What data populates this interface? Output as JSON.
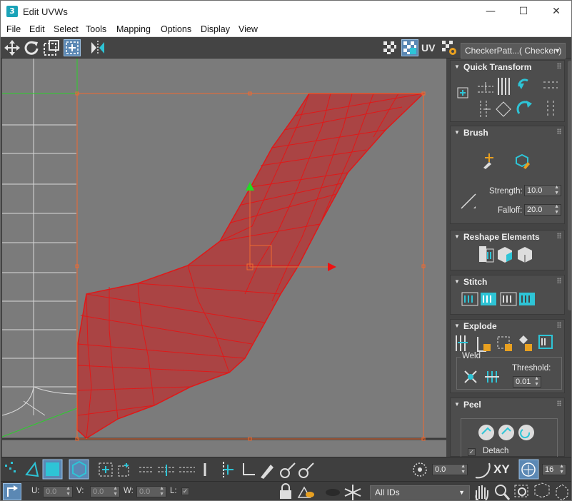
{
  "window": {
    "title": "Edit UVWs",
    "app_icon": "3",
    "minimize": "—",
    "maximize": "☐",
    "close": "✕"
  },
  "menu": [
    "File",
    "Edit",
    "Select",
    "Tools",
    "Mapping",
    "Options",
    "Display",
    "View"
  ],
  "toolbar": {
    "uv_label": "UV",
    "texture_dropdown": "CheckerPatt...( Checker )"
  },
  "panel": {
    "quick_transform": {
      "title": "Quick Transform"
    },
    "brush": {
      "title": "Brush",
      "strength_label": "Strength:",
      "strength_value": "10.0",
      "falloff_label": "Falloff:",
      "falloff_value": "20.0"
    },
    "reshape": {
      "title": "Reshape Elements"
    },
    "stitch": {
      "title": "Stitch"
    },
    "explode": {
      "title": "Explode",
      "weld_label": "Weld",
      "threshold_label": "Threshold:",
      "threshold_value": "0.01"
    },
    "peel": {
      "title": "Peel",
      "detach_label": "Detach",
      "detach_checked": true
    }
  },
  "bottom1": {
    "rotate_value": "0.0",
    "xy_label": "XY",
    "grid_value": "16"
  },
  "bottom2": {
    "u_label": "U:",
    "u_value": "0.0",
    "v_label": "V:",
    "v_value": "0.0",
    "w_label": "W:",
    "w_value": "0.0",
    "l_label": "L:",
    "ids_dropdown": "All IDs"
  },
  "colors": {
    "accent_cyan": "#2ec4d6",
    "selection_red": "#d01616",
    "viewport_bg": "#7b7b7b",
    "active_button": "#5b88b4"
  }
}
